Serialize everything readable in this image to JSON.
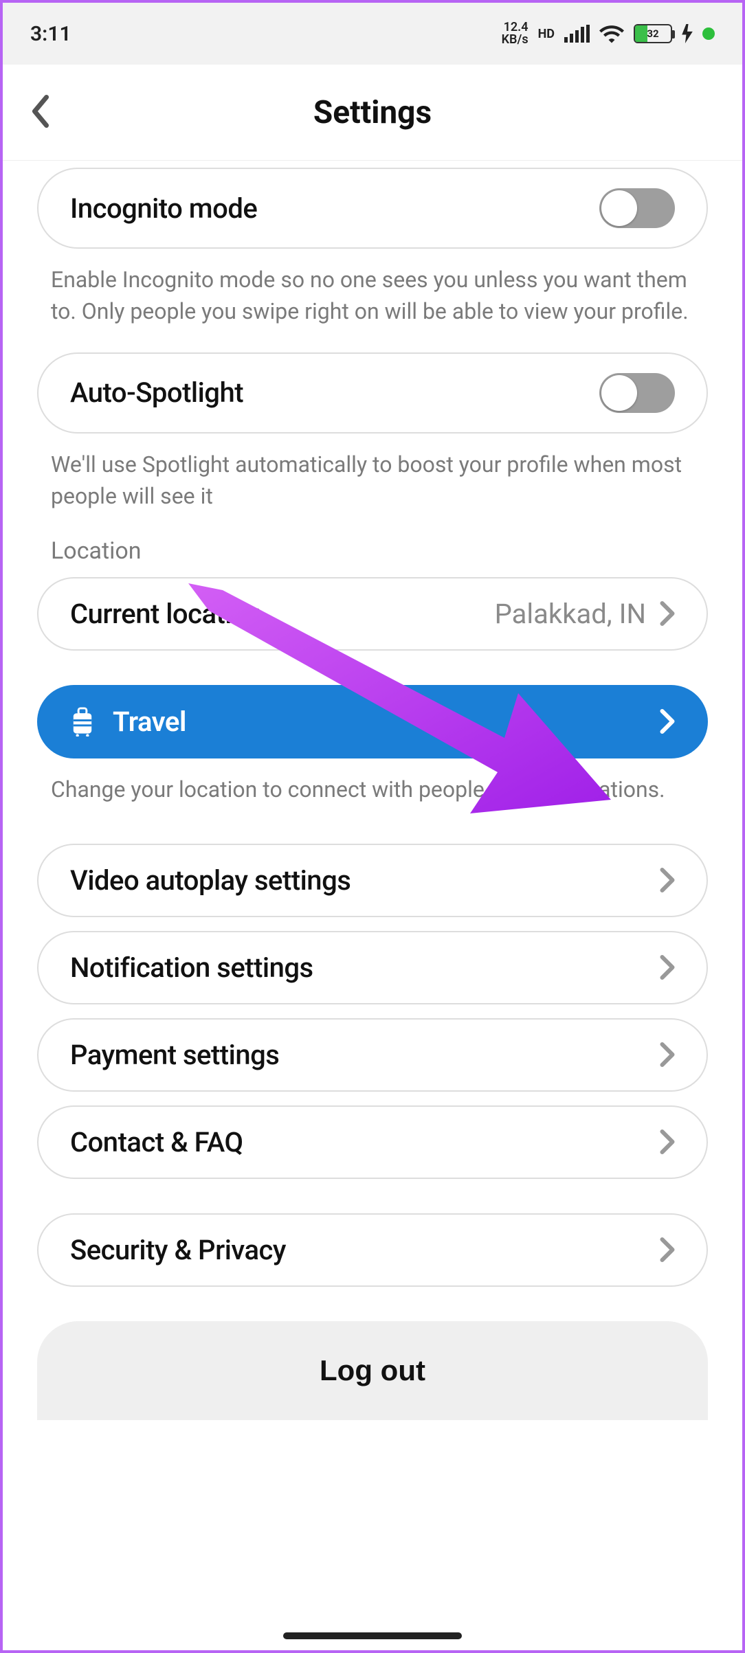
{
  "statusbar": {
    "time": "3:11",
    "net_speed": "12.4",
    "net_unit": "KB/s",
    "hd": "HD",
    "battery_pct": "32"
  },
  "header": {
    "title": "Settings"
  },
  "incognito": {
    "label": "Incognito mode",
    "desc": "Enable Incognito mode so no one sees you unless you want them to. Only people you swipe right on will be able to view your profile."
  },
  "spotlight": {
    "label": "Auto-Spotlight",
    "desc": "We'll use Spotlight automatically to boost your profile when most people will see it"
  },
  "location": {
    "section": "Location",
    "current_label": "Current location",
    "current_value": "Palakkad, IN",
    "travel_label": "Travel",
    "travel_desc": "Change your location to connect with people in other locations."
  },
  "rows": {
    "video": "Video autoplay settings",
    "notif": "Notification settings",
    "payment": "Payment settings",
    "contact": "Contact & FAQ",
    "security": "Security & Privacy"
  },
  "logout": "Log out",
  "colors": {
    "accent_blue": "#1b7fd6",
    "arrow_purple": "#b035f0"
  }
}
